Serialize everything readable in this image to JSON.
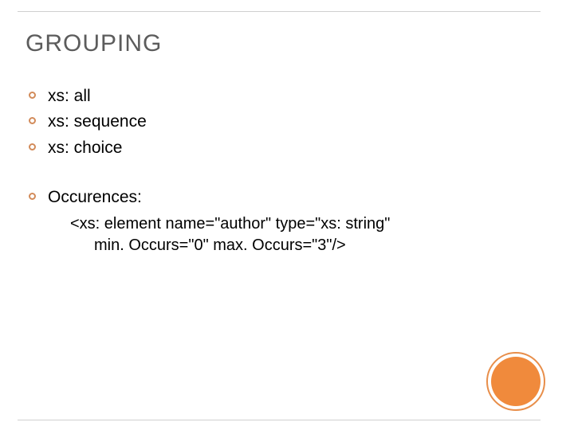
{
  "title": "GROUPING",
  "bullets_group1": [
    "xs: all",
    "xs: sequence",
    "xs: choice"
  ],
  "bullets_group2": [
    "Occurences:"
  ],
  "code": {
    "line1": "<xs: element name=\"author\" type=\"xs: string\"",
    "line2": "min. Occurs=\"0\" max. Occurs=\"3\"/>"
  }
}
